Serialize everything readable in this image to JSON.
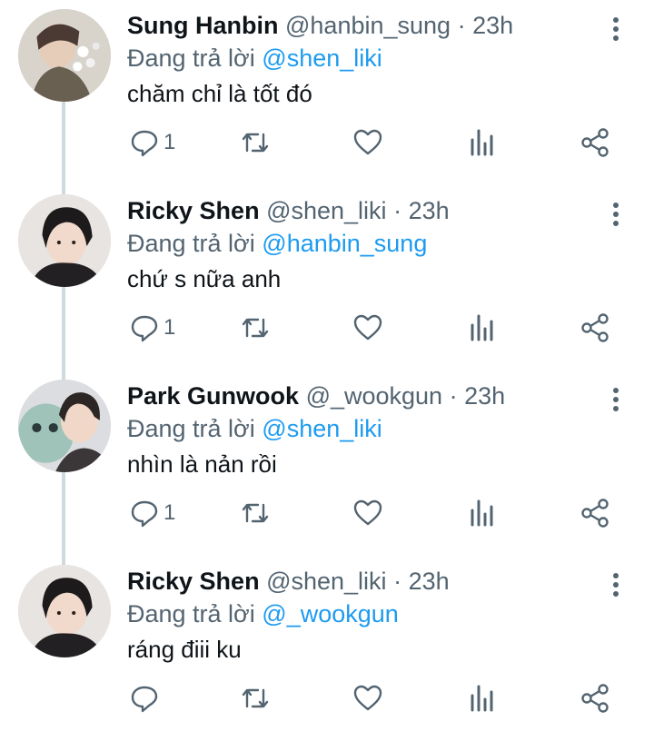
{
  "tweets": [
    {
      "name": "Sung Hanbin",
      "handle": "@hanbin_sung",
      "separator": "·",
      "time": "23h",
      "reply_prefix": "Đang trả lời",
      "reply_to": "@shen_liki",
      "text": "chăm chỉ là tốt đó",
      "reply_count": "1",
      "avatar": "avatar-sung-hanbin"
    },
    {
      "name": "Ricky Shen",
      "handle": "@shen_liki",
      "separator": "·",
      "time": "23h",
      "reply_prefix": "Đang trả lời",
      "reply_to": "@hanbin_sung",
      "text": "chứ s nữa anh",
      "reply_count": "1",
      "avatar": "avatar-ricky-shen"
    },
    {
      "name": "Park Gunwook",
      "handle": "@_wookgun",
      "separator": "·",
      "time": "23h",
      "reply_prefix": "Đang trả lời",
      "reply_to": "@shen_liki",
      "text": "nhìn là nản rồi",
      "reply_count": "1",
      "avatar": "avatar-park-gunwook"
    },
    {
      "name": "Ricky Shen",
      "handle": "@shen_liki",
      "separator": "·",
      "time": "23h",
      "reply_prefix": "Đang trả lời",
      "reply_to": "@_wookgun",
      "text": "ráng điii ku",
      "reply_count": "",
      "avatar": "avatar-ricky-shen"
    }
  ],
  "colors": {
    "text": "#0f1419",
    "secondary": "#536471",
    "mention": "#1d9bf0",
    "thread_line": "#cfd9de"
  },
  "icons": [
    "reply-icon",
    "retweet-icon",
    "like-icon",
    "views-icon",
    "share-icon",
    "more-options-icon"
  ]
}
